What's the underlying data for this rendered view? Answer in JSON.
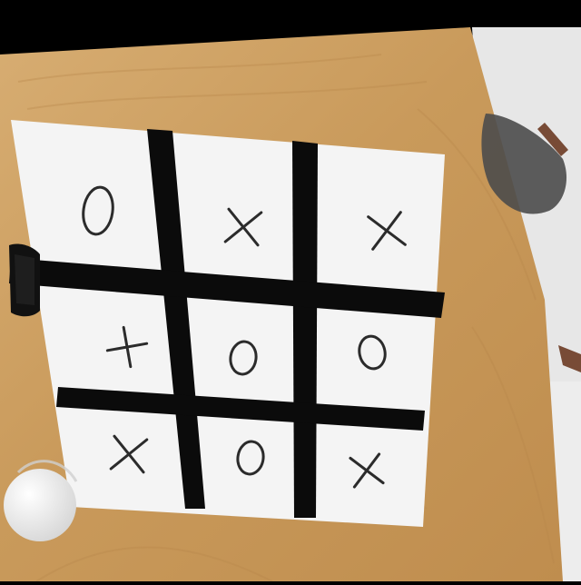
{
  "scene": {
    "description_free": true,
    "table_color": "#C99A5B",
    "table_dark": "#B58445",
    "board_color": "#F4F4F4",
    "tape_color": "#0B0B0B",
    "ink_color": "#2B2B2B"
  },
  "board": {
    "rows": 3,
    "cols": 3,
    "cells": [
      [
        "O",
        "X",
        "X"
      ],
      [
        "+",
        "O",
        "O"
      ],
      [
        "X",
        "O",
        "X"
      ]
    ]
  }
}
